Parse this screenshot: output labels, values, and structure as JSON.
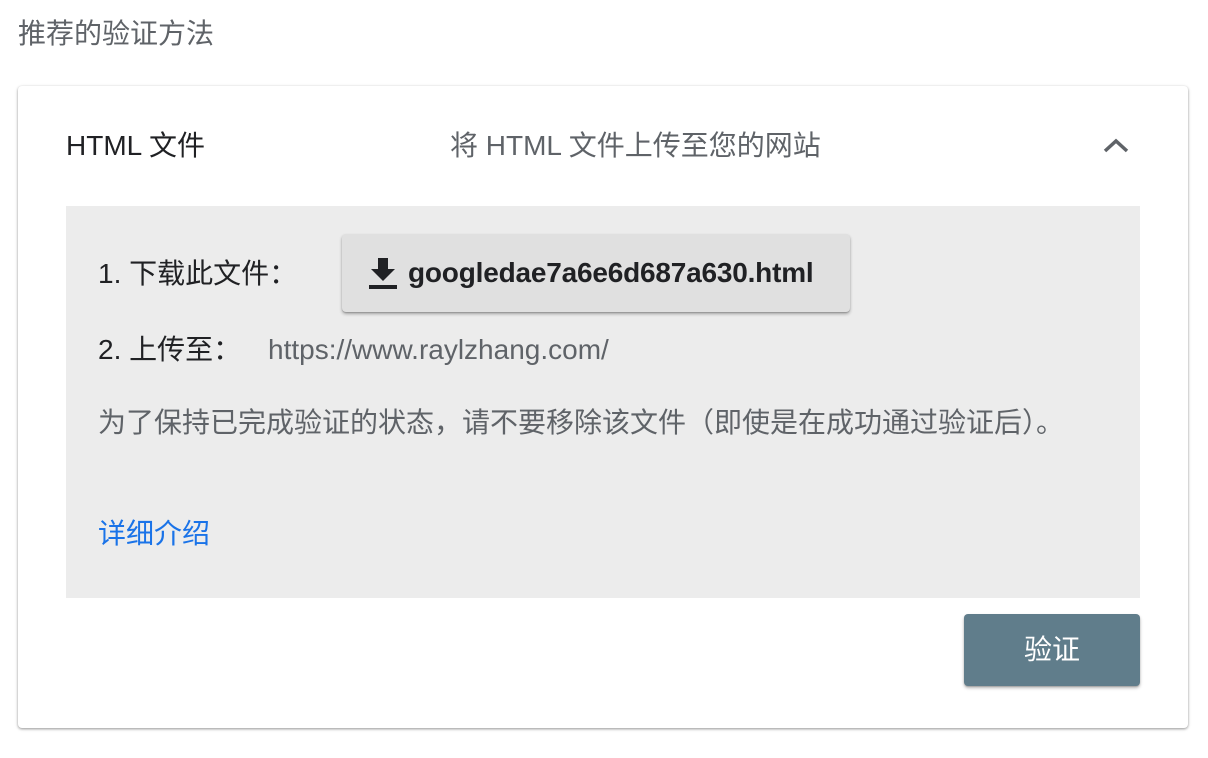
{
  "section": {
    "title": "推荐的验证方法"
  },
  "method": {
    "name": "HTML 文件",
    "description": "将 HTML 文件上传至您的网站",
    "expanded": true,
    "collapse_icon": "chevron-up-icon"
  },
  "steps": {
    "download_label": "1. 下载此文件：",
    "download_icon": "download-icon",
    "filename": "googledae7a6e6d687a630.html",
    "upload_label": "2. 上传至：",
    "site_url": "https://www.raylzhang.com/"
  },
  "note": "为了保持已完成验证的状态，请不要移除该文件（即使是在成功通过验证后）。",
  "learn_more": "详细介绍",
  "verify_button": "验证",
  "colors": {
    "link": "#1a73e8",
    "verify_button_bg": "#607d8b",
    "panel_bg": "#ececec"
  }
}
